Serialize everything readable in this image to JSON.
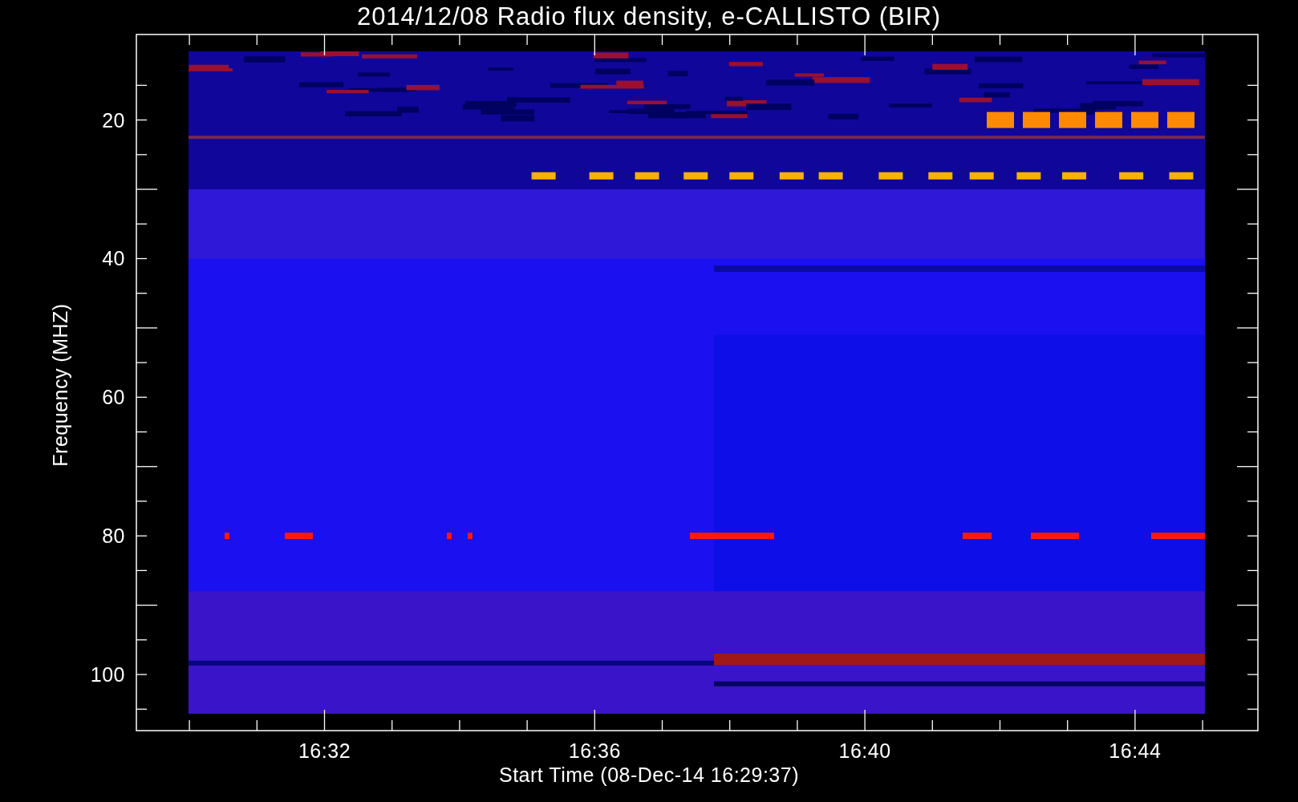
{
  "title": "2014/12/08  Radio flux density, e-CALLISTO (BIR)",
  "y_axis": {
    "label": "Frequency (MHZ)",
    "ticks": [
      "20",
      "40",
      "60",
      "80",
      "100"
    ]
  },
  "x_axis": {
    "label": "Start Time (08-Dec-14 16:29:37)",
    "ticks": [
      "16:32",
      "16:36",
      "16:40",
      "16:44"
    ]
  }
}
